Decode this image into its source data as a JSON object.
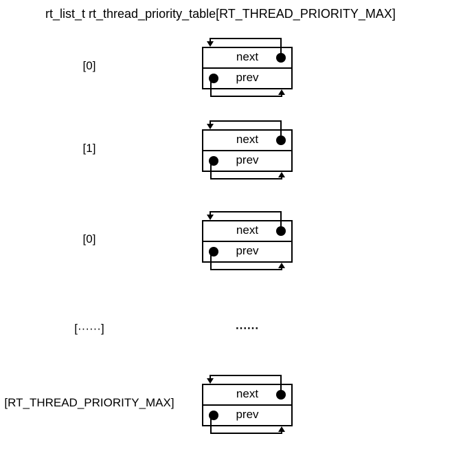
{
  "title": "rt_list_t rt_thread_priority_table[RT_THREAD_PRIORITY_MAX]",
  "rows": [
    {
      "index": "[0]",
      "next": "next",
      "prev": "prev"
    },
    {
      "index": "[1]",
      "next": "next",
      "prev": "prev"
    },
    {
      "index": "[0]",
      "next": "next",
      "prev": "prev"
    },
    {
      "index": "[······]",
      "ellipsis": "······"
    },
    {
      "index": "[RT_THREAD_PRIORITY_MAX]",
      "next": "next",
      "prev": "prev"
    }
  ]
}
